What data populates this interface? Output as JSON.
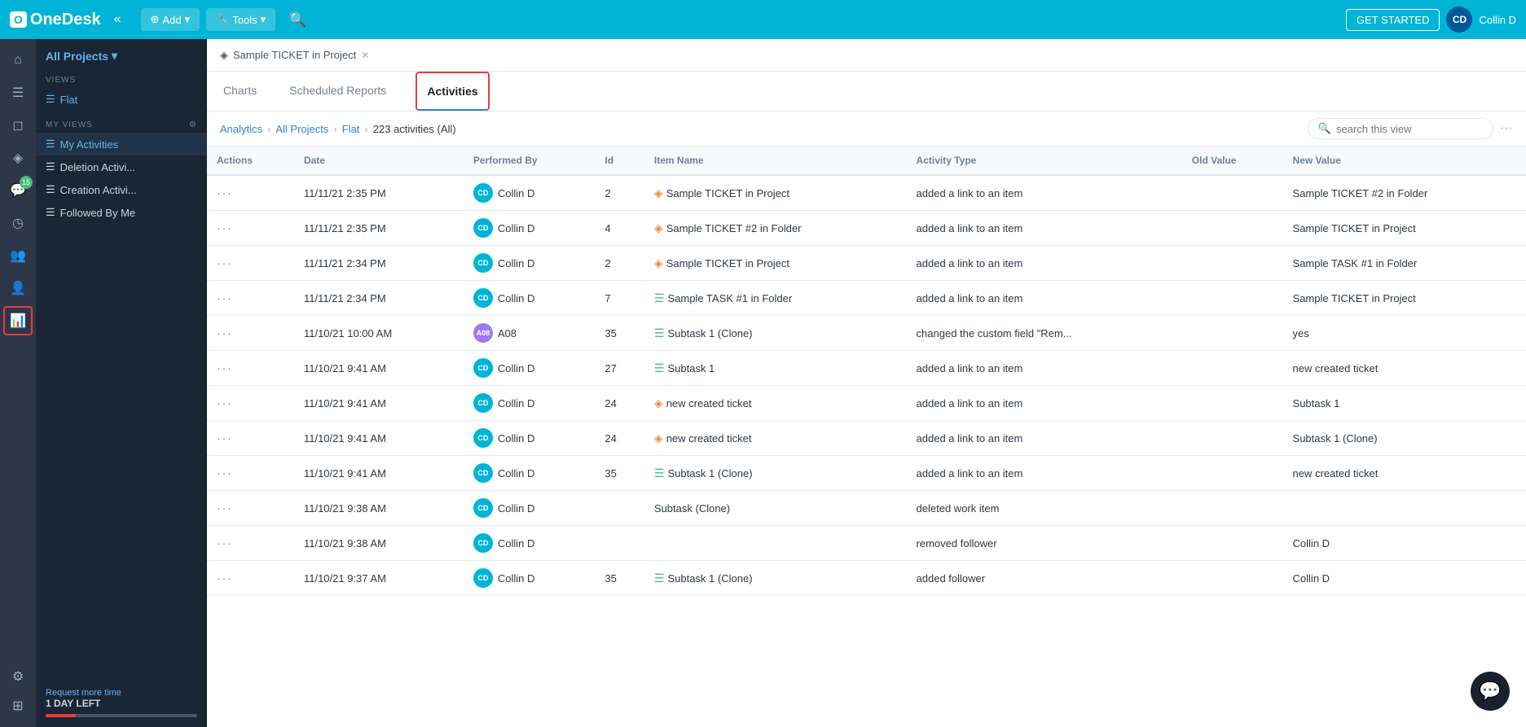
{
  "topnav": {
    "logo_text": "OneDesk",
    "logo_icon": "O",
    "collapse_icon": "«",
    "add_label": "Add",
    "tools_label": "Tools",
    "get_started_label": "GET STARTED",
    "user_initials": "CD",
    "username": "Collin D"
  },
  "sidebar": {
    "all_projects_label": "All Projects",
    "views_label": "VIEWS",
    "flat_label": "Flat",
    "my_views_label": "MY VIEWS",
    "my_views_items": [
      {
        "label": "My Activities"
      },
      {
        "label": "Deletion Activi..."
      },
      {
        "label": "Creation Activi..."
      },
      {
        "label": "Followed By Me"
      }
    ],
    "footer": {
      "request_label": "Request more time",
      "day_left": "1 DAY LEFT"
    },
    "icons": [
      {
        "name": "home-icon",
        "symbol": "⌂"
      },
      {
        "name": "list-icon",
        "symbol": "☰"
      },
      {
        "name": "inbox-icon",
        "symbol": "◻"
      },
      {
        "name": "ticket-icon",
        "symbol": "◈"
      },
      {
        "name": "chat-icon",
        "symbol": "💬",
        "badge": "15"
      },
      {
        "name": "clock-icon",
        "symbol": "◷"
      },
      {
        "name": "users-icon",
        "symbol": "👥"
      },
      {
        "name": "contact-icon",
        "symbol": "👤"
      },
      {
        "name": "analytics-icon",
        "symbol": "📊",
        "active": true
      },
      {
        "name": "settings-icon",
        "symbol": "⚙"
      },
      {
        "name": "apps-icon",
        "symbol": "⊞"
      }
    ]
  },
  "tabs": {
    "breadcrumb_tab_label": "Sample TICKET in Project",
    "items": [
      {
        "label": "Charts",
        "active": false
      },
      {
        "label": "Scheduled Reports",
        "active": false
      },
      {
        "label": "Activities",
        "active": true
      }
    ]
  },
  "breadcrumb": {
    "items": [
      {
        "label": "Analytics"
      },
      {
        "label": "All Projects"
      },
      {
        "label": "Flat"
      },
      {
        "label": "223 activities (All)"
      }
    ]
  },
  "search": {
    "placeholder": "search this view"
  },
  "table": {
    "columns": [
      "Actions",
      "Date",
      "Performed By",
      "Id",
      "Item Name",
      "Activity Type",
      "Old Value",
      "New Value"
    ],
    "rows": [
      {
        "date": "11/11/21 2:35 PM",
        "performed_by": "Collin D",
        "avatar": "CD",
        "avatar_class": "cd",
        "id": "2",
        "item_name": "Sample TICKET in Project",
        "item_icon": "ticket",
        "activity_type": "added a link to an item",
        "old_value": "",
        "new_value": "Sample TICKET #2 in Folder"
      },
      {
        "date": "11/11/21 2:35 PM",
        "performed_by": "Collin D",
        "avatar": "CD",
        "avatar_class": "cd",
        "id": "4",
        "item_name": "Sample TICKET #2 in Folder",
        "item_icon": "ticket",
        "activity_type": "added a link to an item",
        "old_value": "",
        "new_value": "Sample TICKET in Project"
      },
      {
        "date": "11/11/21 2:34 PM",
        "performed_by": "Collin D",
        "avatar": "CD",
        "avatar_class": "cd",
        "id": "2",
        "item_name": "Sample TICKET in Project",
        "item_icon": "ticket",
        "activity_type": "added a link to an item",
        "old_value": "",
        "new_value": "Sample TASK #1 in Folder"
      },
      {
        "date": "11/11/21 2:34 PM",
        "performed_by": "Collin D",
        "avatar": "CD",
        "avatar_class": "cd",
        "id": "7",
        "item_name": "Sample TASK #1 in Folder",
        "item_icon": "task",
        "activity_type": "added a link to an item",
        "old_value": "",
        "new_value": "Sample TICKET in Project"
      },
      {
        "date": "11/10/21 10:00 AM",
        "performed_by": "A08",
        "avatar": "A08",
        "avatar_class": "a08",
        "id": "35",
        "item_name": "Subtask 1 (Clone)",
        "item_icon": "task",
        "activity_type": "changed the custom field \"Rem...",
        "old_value": "",
        "new_value": "yes"
      },
      {
        "date": "11/10/21 9:41 AM",
        "performed_by": "Collin D",
        "avatar": "CD",
        "avatar_class": "cd",
        "id": "27",
        "item_name": "Subtask 1",
        "item_icon": "task",
        "activity_type": "added a link to an item",
        "old_value": "",
        "new_value": "new created ticket"
      },
      {
        "date": "11/10/21 9:41 AM",
        "performed_by": "Collin D",
        "avatar": "CD",
        "avatar_class": "cd",
        "id": "24",
        "item_name": "new created ticket",
        "item_icon": "ticket",
        "activity_type": "added a link to an item",
        "old_value": "",
        "new_value": "Subtask 1"
      },
      {
        "date": "11/10/21 9:41 AM",
        "performed_by": "Collin D",
        "avatar": "CD",
        "avatar_class": "cd",
        "id": "24",
        "item_name": "new created ticket",
        "item_icon": "ticket",
        "activity_type": "added a link to an item",
        "old_value": "",
        "new_value": "Subtask 1 (Clone)"
      },
      {
        "date": "11/10/21 9:41 AM",
        "performed_by": "Collin D",
        "avatar": "CD",
        "avatar_class": "cd",
        "id": "35",
        "item_name": "Subtask 1 (Clone)",
        "item_icon": "task",
        "activity_type": "added a link to an item",
        "old_value": "",
        "new_value": "new created ticket"
      },
      {
        "date": "11/10/21 9:38 AM",
        "performed_by": "Collin D",
        "avatar": "CD",
        "avatar_class": "cd",
        "id": "",
        "item_name": "Subtask (Clone)",
        "item_icon": "none",
        "activity_type": "deleted work item",
        "old_value": "",
        "new_value": ""
      },
      {
        "date": "11/10/21 9:38 AM",
        "performed_by": "Collin D",
        "avatar": "CD",
        "avatar_class": "cd",
        "id": "",
        "item_name": "",
        "item_icon": "none",
        "activity_type": "removed follower",
        "old_value": "",
        "new_value": "Collin D"
      },
      {
        "date": "11/10/21 9:37 AM",
        "performed_by": "Collin D",
        "avatar": "CD",
        "avatar_class": "cd",
        "id": "35",
        "item_name": "Subtask 1 (Clone)",
        "item_icon": "task",
        "activity_type": "added follower",
        "old_value": "",
        "new_value": "Collin D"
      }
    ]
  }
}
